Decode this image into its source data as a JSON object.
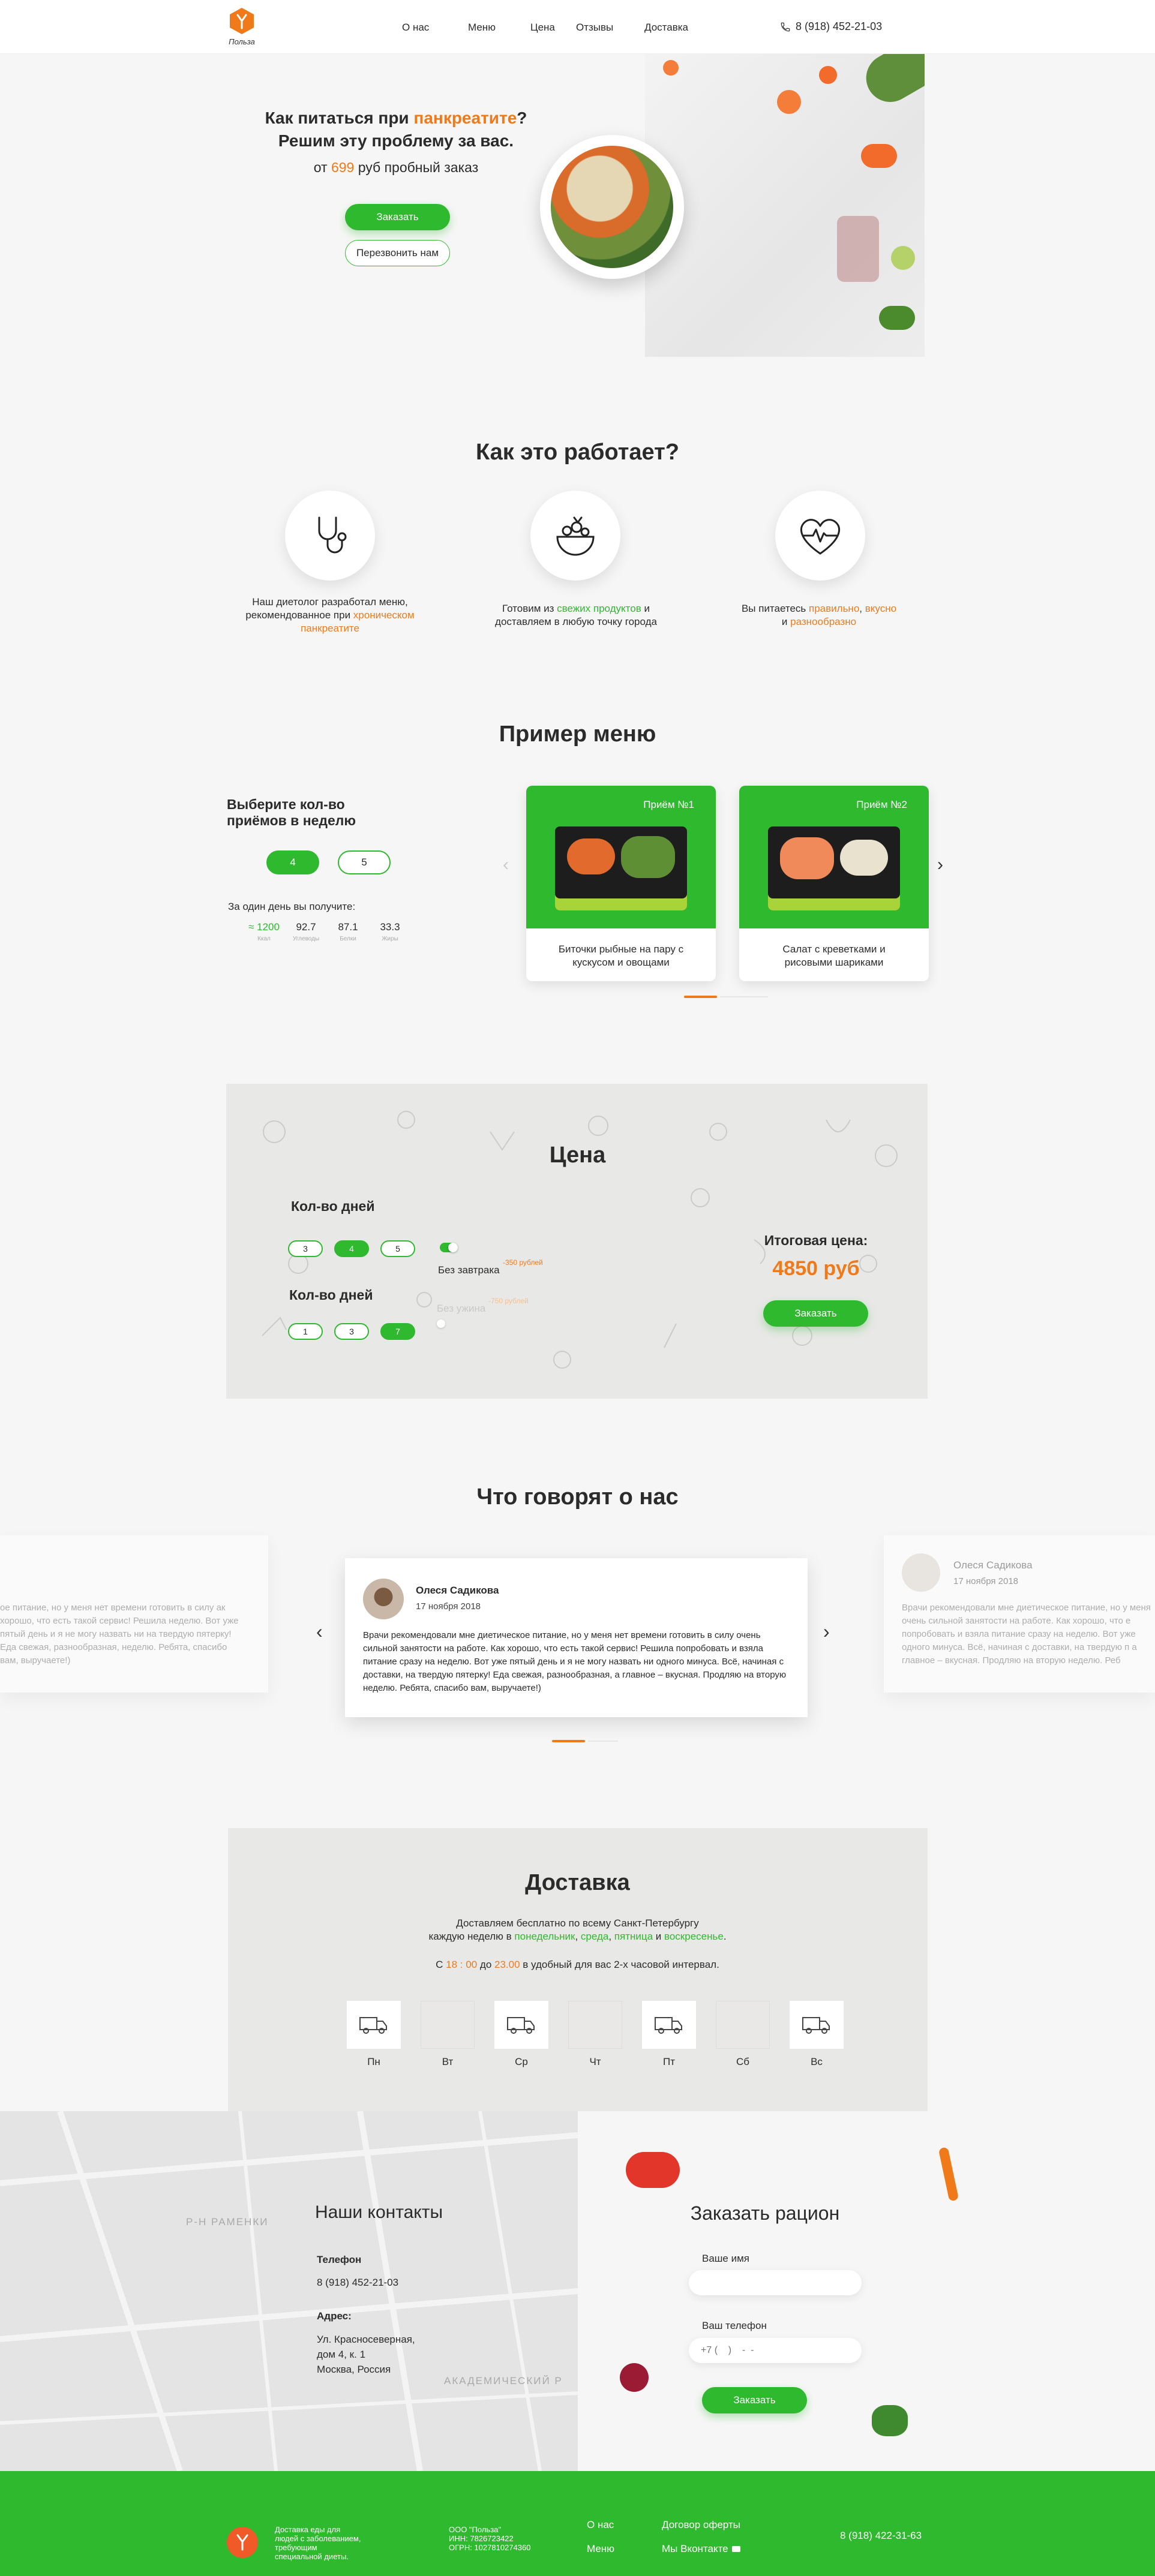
{
  "header": {
    "logo_text": "Польза",
    "nav": [
      "О нас",
      "Меню",
      "Цена",
      "Отзывы",
      "Доставка"
    ],
    "phone": "8 (918) 452-21-03"
  },
  "hero": {
    "title_part1": "Как питаться при ",
    "title_highlight": "панкреатите",
    "title_part2": "?",
    "title_line2": "Решим эту проблему за вас.",
    "price_prefix": "от ",
    "price_value": "699",
    "price_suffix": " руб пробный заказ",
    "order_button": "Заказать",
    "call_button": "Перезвонить нам"
  },
  "how": {
    "title": "Как это работает?",
    "step1_a": "Наш диетолог разработал меню,",
    "step1_b": "рекомендованное при ",
    "step1_hl": "хроническом",
    "step1_c": "панкреатите",
    "step2_a": "Готовим из ",
    "step2_hl": "свежих продуктов",
    "step2_b": " и",
    "step2_c": "доставляем в любую точку города",
    "step3_a": "Вы питаетесь ",
    "step3_hl1": "правильно",
    "step3_sep": ", ",
    "step3_hl2": "вкусно",
    "step3_b": "и ",
    "step3_hl3": "разнообразно"
  },
  "menu": {
    "title": "Пример меню",
    "choose_label": "Выберите кол-во приёмов в неделю",
    "options": [
      "4",
      "5"
    ],
    "per_day_label": "За один день вы получите:",
    "stats": [
      {
        "value": "≈ 1200",
        "label": "Ккал"
      },
      {
        "value": "92.7",
        "label": "Углеводы"
      },
      {
        "value": "87.1",
        "label": "Белки"
      },
      {
        "value": "33.3",
        "label": "Жиры"
      }
    ],
    "cards": [
      {
        "tag": "Приём №1",
        "name": "Биточки рыбные на пару с кускусом и овощами"
      },
      {
        "tag": "Приём №2",
        "name": "Салат с креветками и рисовыми шариками"
      }
    ]
  },
  "price": {
    "title": "Цена",
    "days_label": "Кол-во дней",
    "days_options": [
      "3",
      "4",
      "5"
    ],
    "meals_label": "Кол-во дней",
    "meals_options": [
      "1",
      "3",
      "7"
    ],
    "no_breakfast": "Без завтрака",
    "no_breakfast_price": "-350 рублей",
    "no_dinner": "Без ужина",
    "no_dinner_price": "-750 рублей",
    "total_label": "Итоговая цена:",
    "total_value": "4850 руб",
    "order_button": "Заказать"
  },
  "reviews": {
    "title": "Что говорят о нас",
    "items": [
      {
        "name": "Олеся Садикова",
        "date": "17 ноября 2018",
        "text": "Врачи рекомендовали мне диетическое питание, но у меня нет времени готовить в силу очень сильной занятости на работе. Как хорошо, что есть такой сервис! Решила попробовать и взяла питание сразу на неделю. Вот уже пятый день и я не могу назвать ни одного минуса. Всё, начиная с доставки, на твердую пятерку! Еда свежая, разнообразная, а главное – вкусная. Продляю на вторую неделю. Ребята, спасибо вам, выручаете!)"
      }
    ],
    "left_ghost_text": "ое питание, но у меня нет времени готовить в силу ак хорошо, что есть такой сервис! Решила неделю. Вот уже пятый день и я не могу назвать ни на твердую пятерку! Еда свежая, разнообразная, неделю. Ребята, спасибо вам, выручаете!)",
    "right_ghost_text": "Врачи рекомендовали мне диетическое питание, но у меня очень сильной занятости на работе. Как хорошо, что е попробовать и взяла питание сразу на неделю. Вот уже одного минуса. Всё, начиная с доставки, на твердую п а главное – вкусная. Продляю на вторую неделю. Реб"
  },
  "delivery": {
    "title": "Доставка",
    "line1": "Доставляем бесплатно по всему Санкт-Петербургу",
    "line2_a": "каждую неделю в ",
    "day_mon": "понедельник",
    "comma1": ", ",
    "day_wed": "среда",
    "comma2": ", ",
    "day_fri": "пятница",
    "and": " и ",
    "day_sun": "воскресенье",
    "dot": ".",
    "time_a": "С ",
    "time_from": "18 : 00",
    "time_b": " до ",
    "time_to": "23.00",
    "time_c": " в удобный для вас 2-х часовой интервал.",
    "days": [
      {
        "name": "Пн",
        "active": true
      },
      {
        "name": "Вт",
        "active": false
      },
      {
        "name": "Ср",
        "active": true
      },
      {
        "name": "Чт",
        "active": false
      },
      {
        "name": "Пт",
        "active": true
      },
      {
        "name": "Сб",
        "active": false
      },
      {
        "name": "Вс",
        "active": true
      }
    ]
  },
  "contacts": {
    "title": "Наши контакты",
    "phone_label": "Телефон",
    "phone": "8 (918) 452-21-03",
    "address_label": "Адрес:",
    "address_line1": "Ул. Красносеверная,",
    "address_line2": "дом 4, к. 1",
    "address_line3": "Москва, Россия",
    "map_label1": "Р-Н РАМЕНКИ",
    "map_label2": "АКАДЕМИЧЕСКИЙ Р"
  },
  "order_form": {
    "title": "Заказать рацион",
    "name_label": "Ваше имя",
    "phone_label": "Ваш телефон",
    "phone_placeholder": "+7 (    )    -  -",
    "submit": "Заказать"
  },
  "footer": {
    "about": "Доставка еды для людей с заболеванием, требующим специальной диеты.",
    "company": "ООО \"Польза\"",
    "inn": "ИНН: 7826723422",
    "ogrn": "ОГРН: 1027810274360",
    "link_about": "О нас",
    "link_menu": "Меню",
    "link_offer": "Договор оферты",
    "link_vk": "Мы Вконтакте",
    "phone": "8 (918) 422-31-63"
  },
  "colors": {
    "accent_green": "#2eb92e",
    "accent_orange": "#f07a1a"
  }
}
